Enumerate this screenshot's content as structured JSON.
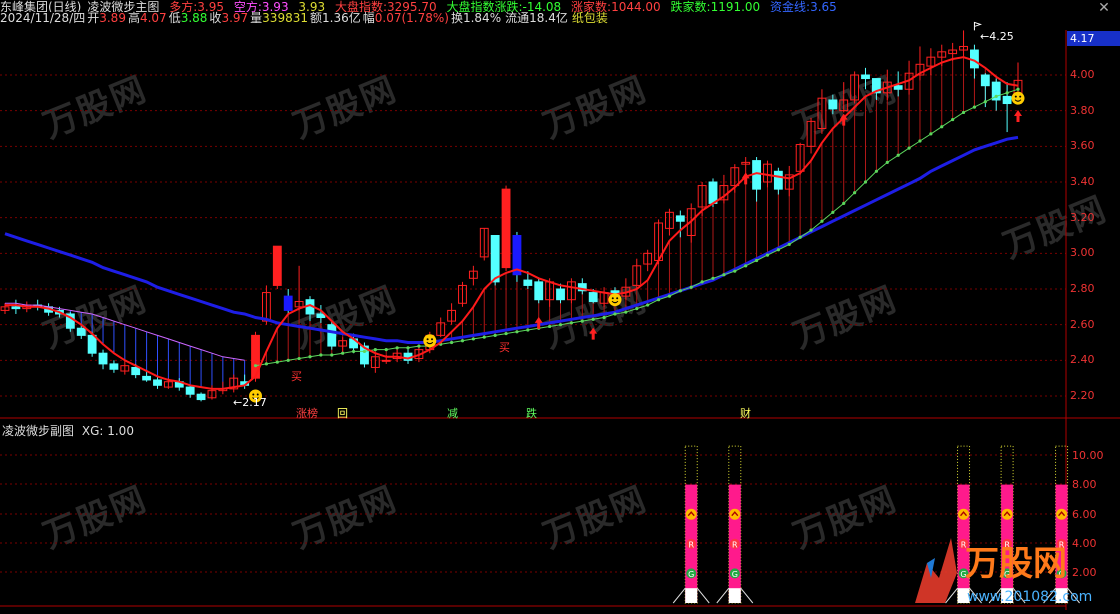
{
  "header": {
    "stock_name": "东峰集团(日线)",
    "indicator": "凌波微步主图",
    "long_label": "多方:",
    "long_value": "3.95",
    "short_label": "空方:",
    "short_value": "3.93",
    "extra_value": "3.93",
    "index_label": "大盘指数:",
    "index_value": "3295.70",
    "index_change_label": "大盘指数涨跌:",
    "index_change_value": "-14.08",
    "up_count_label": "涨家数:",
    "up_count_value": "1044.00",
    "down_count_label": "跌家数:",
    "down_count_value": "1191.00",
    "fund_label": "资金线:",
    "fund_value": "3.65"
  },
  "quote": {
    "date": "2024/11/28/四",
    "open_label": "开",
    "open": "3.89",
    "high_label": "高",
    "high": "4.07",
    "low_label": "低",
    "low": "3.88",
    "close_label": "收",
    "close": "3.97",
    "volume_label": "量",
    "volume": "339831",
    "amount_label": "额",
    "amount": "1.36亿",
    "change_label": "幅",
    "change": "0.07(1.78%)",
    "turnover_label": "换",
    "turnover": "1.84%",
    "float_label": "流通",
    "float": "18.4亿",
    "concept": "纸包装"
  },
  "price_axis": {
    "ticks": [
      "4.00",
      "3.80",
      "3.60",
      "3.40",
      "3.20",
      "3.00",
      "2.80",
      "2.60",
      "2.40",
      "2.20"
    ],
    "current_price": "4.17"
  },
  "annotations": {
    "high_marker": "4.25",
    "low_marker": "2.17",
    "buy_label_1": "买",
    "buy_label_2": "买",
    "signal_1": "涨榜",
    "signal_2": "回",
    "signal_3": "减",
    "signal_4": "跌",
    "signal_5": "财"
  },
  "sub_panel": {
    "title": "凌波微步副图",
    "xg_label": "XG:",
    "xg_value": "1.00",
    "ticks": [
      "10.00",
      "8.00",
      "6.00",
      "4.00",
      "2.00"
    ],
    "badge_r": "R",
    "badge_g": "G"
  },
  "watermark": {
    "text": "万股网",
    "url": "www.201082.com"
  },
  "colors": {
    "up": "#ff2020",
    "down": "#54ffff",
    "ma_red": "#ff1a1a",
    "ma_blue": "#1e1ee6",
    "ma_green": "#5cd65c",
    "sub_pink": "#ff1a8c",
    "grid": "#7a0000"
  },
  "chart_data": {
    "type": "candlestick",
    "ylim": [
      2.1,
      4.27
    ],
    "y_ticks": [
      2.2,
      2.4,
      2.6,
      2.8,
      3.0,
      3.2,
      3.4,
      3.6,
      3.8,
      4.0
    ],
    "candles": [
      [
        2.68,
        2.7,
        2.72,
        2.66
      ],
      [
        2.7,
        2.69,
        2.74,
        2.66
      ],
      [
        2.69,
        2.71,
        2.73,
        2.67
      ],
      [
        2.71,
        2.7,
        2.74,
        2.68
      ],
      [
        2.7,
        2.67,
        2.72,
        2.65
      ],
      [
        2.68,
        2.66,
        2.7,
        2.64
      ],
      [
        2.66,
        2.58,
        2.67,
        2.56
      ],
      [
        2.58,
        2.54,
        2.6,
        2.52
      ],
      [
        2.54,
        2.44,
        2.56,
        2.42
      ],
      [
        2.44,
        2.38,
        2.46,
        2.35
      ],
      [
        2.38,
        2.35,
        2.4,
        2.33
      ],
      [
        2.34,
        2.37,
        2.4,
        2.32
      ],
      [
        2.36,
        2.32,
        2.38,
        2.3
      ],
      [
        2.31,
        2.29,
        2.34,
        2.28
      ],
      [
        2.29,
        2.26,
        2.31,
        2.24
      ],
      [
        2.25,
        2.28,
        2.3,
        2.24
      ],
      [
        2.28,
        2.25,
        2.3,
        2.23
      ],
      [
        2.25,
        2.21,
        2.26,
        2.19
      ],
      [
        2.21,
        2.18,
        2.22,
        2.17
      ],
      [
        2.19,
        2.23,
        2.26,
        2.18
      ],
      [
        2.23,
        2.24,
        2.28,
        2.21
      ],
      [
        2.24,
        2.3,
        2.32,
        2.22
      ],
      [
        2.28,
        2.26,
        2.32,
        2.24
      ],
      [
        2.3,
        2.54,
        2.56,
        2.28
      ],
      [
        2.62,
        2.78,
        2.82,
        2.6
      ],
      [
        2.82,
        3.04,
        3.04,
        2.8
      ],
      [
        2.76,
        2.68,
        2.8,
        2.66
      ],
      [
        2.7,
        2.73,
        2.93,
        2.68
      ],
      [
        2.74,
        2.66,
        2.76,
        2.62
      ],
      [
        2.66,
        2.64,
        2.71,
        2.61
      ],
      [
        2.6,
        2.48,
        2.62,
        2.46
      ],
      [
        2.48,
        2.51,
        2.53,
        2.44
      ],
      [
        2.52,
        2.47,
        2.55,
        2.44
      ],
      [
        2.48,
        2.38,
        2.5,
        2.36
      ],
      [
        2.36,
        2.42,
        2.44,
        2.33
      ],
      [
        2.4,
        2.4,
        2.43,
        2.38
      ],
      [
        2.41,
        2.44,
        2.46,
        2.39
      ],
      [
        2.44,
        2.4,
        2.46,
        2.38
      ],
      [
        2.41,
        2.46,
        2.49,
        2.39
      ],
      [
        2.46,
        2.54,
        2.56,
        2.44
      ],
      [
        2.54,
        2.61,
        2.64,
        2.53
      ],
      [
        2.62,
        2.68,
        2.72,
        2.6
      ],
      [
        2.72,
        2.82,
        2.84,
        2.7
      ],
      [
        2.86,
        2.9,
        2.93,
        2.82
      ],
      [
        2.98,
        3.14,
        3.14,
        2.96
      ],
      [
        3.1,
        2.84,
        3.1,
        2.82
      ],
      [
        2.92,
        3.36,
        3.38,
        2.9
      ],
      [
        3.1,
        2.88,
        3.12,
        2.84
      ],
      [
        2.85,
        2.82,
        2.9,
        2.8
      ],
      [
        2.84,
        2.74,
        2.86,
        2.72
      ],
      [
        2.74,
        2.84,
        2.86,
        2.7
      ],
      [
        2.8,
        2.74,
        2.83,
        2.72
      ],
      [
        2.74,
        2.84,
        2.86,
        2.72
      ],
      [
        2.83,
        2.79,
        2.86,
        2.77
      ],
      [
        2.78,
        2.73,
        2.8,
        2.72
      ],
      [
        2.72,
        2.78,
        2.81,
        2.7
      ],
      [
        2.79,
        2.75,
        2.81,
        2.71
      ],
      [
        2.76,
        2.81,
        2.86,
        2.74
      ],
      [
        2.82,
        2.93,
        2.97,
        2.8
      ],
      [
        2.94,
        3.0,
        3.02,
        2.9
      ],
      [
        2.96,
        3.17,
        3.19,
        2.94
      ],
      [
        3.14,
        3.23,
        3.25,
        3.1
      ],
      [
        3.21,
        3.18,
        3.24,
        3.09
      ],
      [
        3.1,
        3.25,
        3.28,
        3.06
      ],
      [
        3.26,
        3.38,
        3.4,
        3.21
      ],
      [
        3.4,
        3.28,
        3.42,
        3.26
      ],
      [
        3.3,
        3.38,
        3.44,
        3.28
      ],
      [
        3.38,
        3.48,
        3.5,
        3.34
      ],
      [
        3.5,
        3.51,
        3.54,
        3.44
      ],
      [
        3.52,
        3.36,
        3.54,
        3.29
      ],
      [
        3.4,
        3.5,
        3.52,
        3.37
      ],
      [
        3.46,
        3.36,
        3.48,
        3.33
      ],
      [
        3.36,
        3.44,
        3.49,
        3.32
      ],
      [
        3.46,
        3.61,
        3.62,
        3.44
      ],
      [
        3.6,
        3.74,
        3.76,
        3.56
      ],
      [
        3.7,
        3.87,
        3.92,
        3.67
      ],
      [
        3.86,
        3.81,
        3.89,
        3.78
      ],
      [
        3.8,
        3.86,
        3.96,
        3.79
      ],
      [
        3.86,
        4.0,
        4.02,
        3.84
      ],
      [
        4.0,
        3.98,
        4.04,
        3.92
      ],
      [
        3.98,
        3.9,
        3.98,
        3.86
      ],
      [
        3.9,
        3.96,
        4.03,
        3.86
      ],
      [
        3.94,
        3.92,
        4.02,
        3.88
      ],
      [
        3.92,
        4.01,
        4.08,
        3.89
      ],
      [
        4.0,
        4.06,
        4.16,
        3.97
      ],
      [
        4.05,
        4.1,
        4.15,
        4.0
      ],
      [
        4.1,
        4.13,
        4.17,
        4.05
      ],
      [
        4.12,
        4.14,
        4.18,
        4.08
      ],
      [
        4.14,
        4.16,
        4.25,
        4.1
      ],
      [
        4.14,
        4.04,
        4.17,
        3.98
      ],
      [
        4.0,
        3.94,
        4.01,
        3.82
      ],
      [
        3.96,
        3.86,
        3.98,
        3.8
      ],
      [
        3.88,
        3.84,
        3.96,
        3.68
      ],
      [
        3.89,
        3.97,
        4.07,
        3.88
      ]
    ],
    "ma_red": [
      2.71,
      2.71,
      2.7,
      2.7,
      2.69,
      2.67,
      2.64,
      2.6,
      2.55,
      2.49,
      2.44,
      2.4,
      2.37,
      2.34,
      2.31,
      2.29,
      2.28,
      2.26,
      2.25,
      2.24,
      2.24,
      2.25,
      2.26,
      2.31,
      2.45,
      2.58,
      2.66,
      2.69,
      2.71,
      2.68,
      2.62,
      2.56,
      2.52,
      2.47,
      2.44,
      2.42,
      2.42,
      2.41,
      2.43,
      2.46,
      2.5,
      2.56,
      2.62,
      2.7,
      2.8,
      2.86,
      2.89,
      2.91,
      2.89,
      2.86,
      2.84,
      2.82,
      2.81,
      2.8,
      2.79,
      2.78,
      2.77,
      2.78,
      2.8,
      2.85,
      2.96,
      3.07,
      3.13,
      3.18,
      3.24,
      3.28,
      3.32,
      3.37,
      3.43,
      3.45,
      3.44,
      3.43,
      3.42,
      3.45,
      3.52,
      3.62,
      3.7,
      3.76,
      3.82,
      3.88,
      3.91,
      3.93,
      3.95,
      3.97,
      4.01,
      4.04,
      4.07,
      4.09,
      4.1,
      4.08,
      4.04,
      3.99,
      3.95,
      3.94
    ],
    "ma_green": [
      null,
      null,
      null,
      null,
      null,
      null,
      null,
      null,
      null,
      null,
      null,
      null,
      null,
      null,
      null,
      null,
      null,
      null,
      null,
      null,
      null,
      null,
      null,
      2.37,
      2.38,
      2.39,
      2.4,
      2.41,
      2.42,
      2.43,
      2.43,
      2.44,
      2.45,
      2.45,
      2.46,
      2.46,
      2.47,
      2.47,
      2.48,
      2.48,
      2.49,
      2.5,
      2.51,
      2.52,
      2.53,
      2.54,
      2.55,
      2.56,
      2.57,
      2.58,
      2.59,
      2.6,
      2.61,
      2.62,
      2.63,
      2.64,
      2.66,
      2.67,
      2.69,
      2.71,
      2.74,
      2.76,
      2.79,
      2.81,
      2.84,
      2.86,
      2.88,
      2.9,
      2.93,
      2.96,
      2.99,
      3.02,
      3.05,
      3.09,
      3.13,
      3.18,
      3.23,
      3.28,
      3.34,
      3.4,
      3.46,
      3.51,
      3.55,
      3.59,
      3.63,
      3.67,
      3.71,
      3.75,
      3.79,
      3.82,
      3.85,
      3.88,
      3.9,
      3.92
    ],
    "ma_blue": [
      3.11,
      3.09,
      3.07,
      3.05,
      3.03,
      3.01,
      2.99,
      2.97,
      2.95,
      2.92,
      2.9,
      2.88,
      2.86,
      2.84,
      2.81,
      2.79,
      2.77,
      2.75,
      2.73,
      2.71,
      2.69,
      2.67,
      2.66,
      2.64,
      2.63,
      2.61,
      2.6,
      2.59,
      2.58,
      2.57,
      2.56,
      2.55,
      2.54,
      2.53,
      2.52,
      2.51,
      2.51,
      2.5,
      2.5,
      2.5,
      2.51,
      2.52,
      2.53,
      2.54,
      2.55,
      2.56,
      2.57,
      2.58,
      2.59,
      2.6,
      2.61,
      2.62,
      2.63,
      2.64,
      2.65,
      2.66,
      2.67,
      2.69,
      2.71,
      2.73,
      2.75,
      2.77,
      2.79,
      2.81,
      2.83,
      2.85,
      2.88,
      2.91,
      2.94,
      2.97,
      3.0,
      3.03,
      3.06,
      3.09,
      3.12,
      3.15,
      3.18,
      3.21,
      3.24,
      3.27,
      3.3,
      3.33,
      3.36,
      3.39,
      3.42,
      3.46,
      3.49,
      3.52,
      3.55,
      3.58,
      3.6,
      3.62,
      3.64,
      3.65
    ],
    "ma_purple": [
      2.72,
      2.72,
      2.71,
      2.71,
      2.7,
      2.69,
      2.68,
      2.67,
      2.66,
      2.64,
      2.62,
      2.6,
      2.58,
      2.56,
      2.54,
      2.52,
      2.5,
      2.48,
      2.46,
      2.44,
      2.42,
      2.41,
      2.4
    ],
    "sub_signal_bars": [
      63,
      67,
      88,
      92,
      97
    ],
    "sub_ylim": [
      0,
      12
    ]
  }
}
